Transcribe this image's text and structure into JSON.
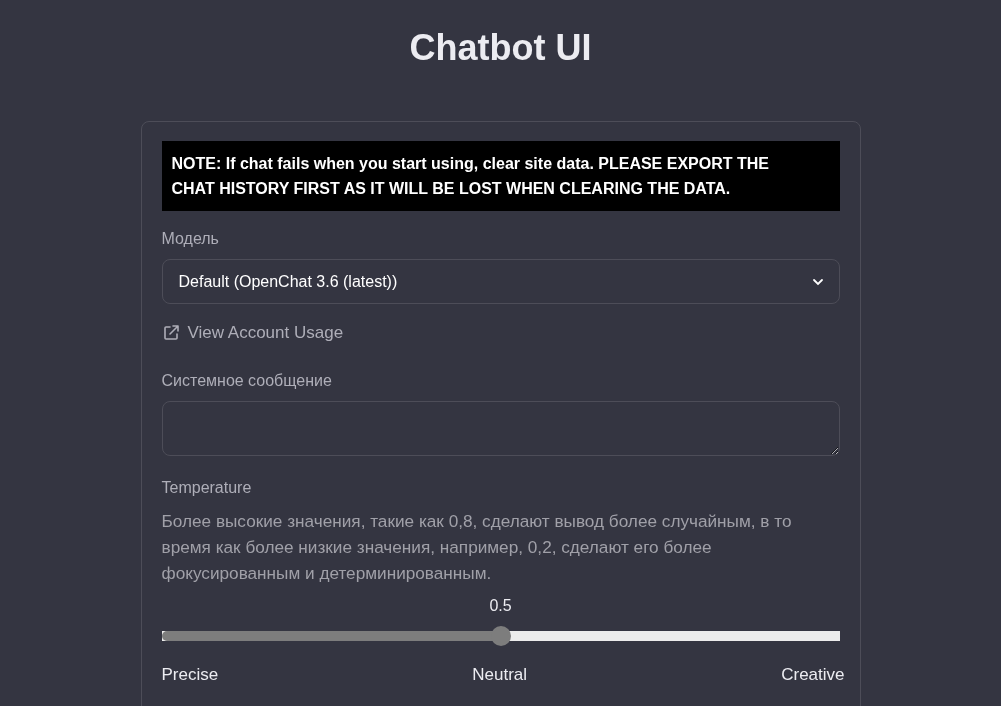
{
  "title": "Chatbot UI",
  "notice": "NOTE: If chat fails when you start using, clear site data. PLEASE EXPORT THE CHAT HISTORY FIRST AS IT WILL BE LOST WHEN CLEARING THE DATA.",
  "model": {
    "label": "Модель",
    "value": "Default (OpenChat 3.6 (latest))"
  },
  "usage_link": "View Account Usage",
  "system_message": {
    "label": "Системное сообщение"
  },
  "temperature": {
    "label": "Temperature",
    "description": "Более высокие значения, такие как 0,8, сделают вывод более случайным, в то время как более низкие значения, например, 0,2, сделают его более фокусированным и детерминированным.",
    "reading": "0.5",
    "level": 0.5,
    "scale_labels": [
      "Precise",
      "Neutral",
      "Creative"
    ]
  }
}
